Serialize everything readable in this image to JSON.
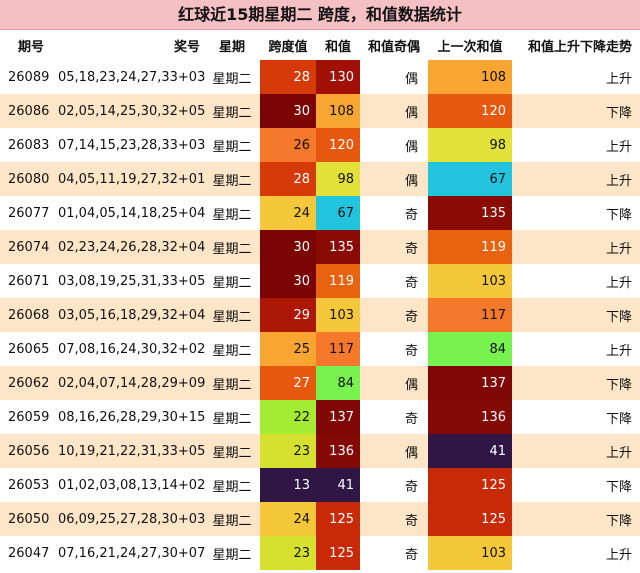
{
  "title": "红球近15期星期二 跨度，和值数据统计",
  "headers": {
    "period": "期号",
    "numbers": "奖号",
    "weekday": "星期",
    "span": "跨度值",
    "sum": "和值",
    "parity": "和值奇偶",
    "prev_sum": "上一次和值",
    "trend": "和值上升下降走势"
  },
  "rows": [
    {
      "period": "26089",
      "numbers": "05,18,23,24,27,33+03",
      "weekday": "星期二",
      "span": "28",
      "sum": "130",
      "parity": "偶",
      "prev_sum": "108",
      "trend": "上升",
      "span_color": "#d63a08",
      "sum_color": "#a01004",
      "prev_color": "#f9a531"
    },
    {
      "period": "26086",
      "numbers": "02,05,14,25,30,32+05",
      "weekday": "星期二",
      "span": "30",
      "sum": "108",
      "parity": "偶",
      "prev_sum": "120",
      "trend": "下降",
      "span_color": "#7b0505",
      "sum_color": "#f9a531",
      "prev_color": "#e5580e"
    },
    {
      "period": "26083",
      "numbers": "07,14,15,23,28,33+03",
      "weekday": "星期二",
      "span": "26",
      "sum": "120",
      "parity": "偶",
      "prev_sum": "98",
      "trend": "上升",
      "span_color": "#f6782a",
      "sum_color": "#e5580e",
      "prev_color": "#e2e13a"
    },
    {
      "period": "26080",
      "numbers": "04,05,11,19,27,32+01",
      "weekday": "星期二",
      "span": "28",
      "sum": "98",
      "parity": "偶",
      "prev_sum": "67",
      "trend": "上升",
      "span_color": "#d63a08",
      "sum_color": "#e2e13a",
      "prev_color": "#21c4dc"
    },
    {
      "period": "26077",
      "numbers": "01,04,05,14,18,25+04",
      "weekday": "星期二",
      "span": "24",
      "sum": "67",
      "parity": "奇",
      "prev_sum": "135",
      "trend": "下降",
      "span_color": "#f5c83b",
      "sum_color": "#21c4dc",
      "prev_color": "#8a0a04"
    },
    {
      "period": "26074",
      "numbers": "02,23,24,26,28,32+04",
      "weekday": "星期二",
      "span": "30",
      "sum": "135",
      "parity": "奇",
      "prev_sum": "119",
      "trend": "上升",
      "span_color": "#7b0505",
      "sum_color": "#8a0a04",
      "prev_color": "#e9620f"
    },
    {
      "period": "26071",
      "numbers": "03,08,19,25,31,33+05",
      "weekday": "星期二",
      "span": "30",
      "sum": "119",
      "parity": "奇",
      "prev_sum": "103",
      "trend": "上升",
      "span_color": "#7b0505",
      "sum_color": "#e9620f",
      "prev_color": "#f5c83b"
    },
    {
      "period": "26068",
      "numbers": "03,05,16,18,29,32+04",
      "weekday": "星期二",
      "span": "29",
      "sum": "103",
      "parity": "奇",
      "prev_sum": "117",
      "trend": "下降",
      "span_color": "#ad1806",
      "sum_color": "#f5c83b",
      "prev_color": "#f6782a"
    },
    {
      "period": "26065",
      "numbers": "07,08,16,24,30,32+02",
      "weekday": "星期二",
      "span": "25",
      "sum": "117",
      "parity": "奇",
      "prev_sum": "84",
      "trend": "上升",
      "span_color": "#f9a531",
      "sum_color": "#f6782a",
      "prev_color": "#78f24e"
    },
    {
      "period": "26062",
      "numbers": "02,04,07,14,28,29+09",
      "weekday": "星期二",
      "span": "27",
      "sum": "84",
      "parity": "偶",
      "prev_sum": "137",
      "trend": "下降",
      "span_color": "#e5580e",
      "sum_color": "#78f24e",
      "prev_color": "#800606"
    },
    {
      "period": "26059",
      "numbers": "08,16,26,28,29,30+15",
      "weekday": "星期二",
      "span": "22",
      "sum": "137",
      "parity": "奇",
      "prev_sum": "136",
      "trend": "下降",
      "span_color": "#a4eb34",
      "sum_color": "#800606",
      "prev_color": "#840806"
    },
    {
      "period": "26056",
      "numbers": "10,19,21,22,31,33+05",
      "weekday": "星期二",
      "span": "23",
      "sum": "136",
      "parity": "偶",
      "prev_sum": "41",
      "trend": "上升",
      "span_color": "#d6e12f",
      "sum_color": "#840806",
      "prev_color": "#2f1644"
    },
    {
      "period": "26053",
      "numbers": "01,02,03,08,13,14+02",
      "weekday": "星期二",
      "span": "13",
      "sum": "41",
      "parity": "奇",
      "prev_sum": "125",
      "trend": "下降",
      "span_color": "#2f1644",
      "sum_color": "#2f1644",
      "prev_color": "#c82a07"
    },
    {
      "period": "26050",
      "numbers": "06,09,25,27,28,30+03",
      "weekday": "星期二",
      "span": "24",
      "sum": "125",
      "parity": "奇",
      "prev_sum": "125",
      "trend": "下降",
      "span_color": "#f5c83b",
      "sum_color": "#c82a07",
      "prev_color": "#c82a07"
    },
    {
      "period": "26047",
      "numbers": "07,16,21,24,27,30+07",
      "weekday": "星期二",
      "span": "23",
      "sum": "125",
      "parity": "奇",
      "prev_sum": "103",
      "trend": "上升",
      "span_color": "#d6e12f",
      "sum_color": "#c82a07",
      "prev_color": "#f5c83b"
    }
  ]
}
